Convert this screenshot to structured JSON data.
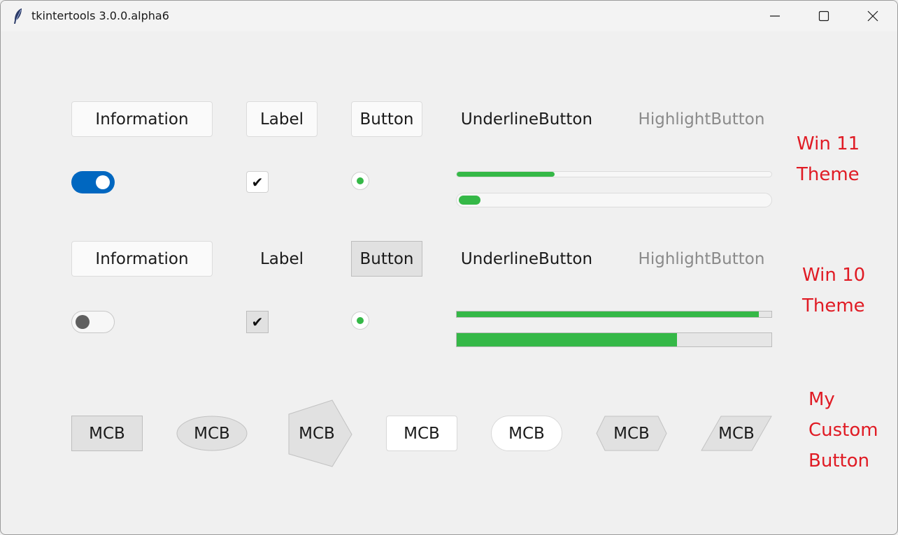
{
  "window": {
    "title": "tkintertools 3.0.0.alpha6",
    "controls": {
      "minimize": "minimize-icon",
      "maximize": "maximize-icon",
      "close": "close-icon"
    }
  },
  "colors": {
    "theme_label": "#e01b24",
    "win11_accent": "#0067c0",
    "progress": "#35b847"
  },
  "win11": {
    "information": "Information",
    "label": "Label",
    "button": "Button",
    "underline_button": "UnderlineButton",
    "highlight_button": "HighlightButton",
    "theme_label": [
      "Win 11",
      "Theme"
    ],
    "switch_on": true,
    "checkbox_checked": true,
    "check_glyph": "✔",
    "radio_selected": true,
    "progress_thin": 0.31,
    "progress_thick": 0.07
  },
  "win10": {
    "information": "Information",
    "label": "Label",
    "button": "Button",
    "underline_button": "UnderlineButton",
    "highlight_button": "HighlightButton",
    "theme_label": [
      "Win 10",
      "Theme"
    ],
    "switch_on": false,
    "checkbox_checked": true,
    "check_glyph": "✔",
    "radio_selected": true,
    "progress_thin": 0.96,
    "progress_thick": 0.7
  },
  "custom": {
    "buttons": [
      "MCB",
      "MCB",
      "MCB",
      "MCB",
      "MCB",
      "MCB",
      "MCB"
    ],
    "theme_label": [
      "My",
      "Custom",
      "Button"
    ]
  }
}
